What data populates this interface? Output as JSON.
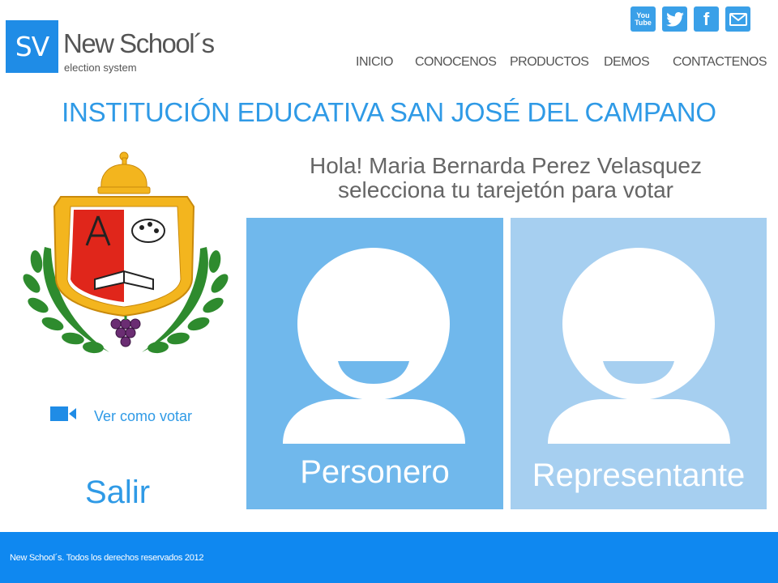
{
  "brand": {
    "initials": "SV",
    "name": "New School´s",
    "tagline": "election system",
    "color": "#1f8ce6"
  },
  "social": [
    {
      "name": "youtube-icon",
      "line1": "You",
      "line2": "Tube"
    },
    {
      "name": "twitter-icon"
    },
    {
      "name": "facebook-icon",
      "glyph": "f"
    },
    {
      "name": "email-icon"
    }
  ],
  "nav": {
    "items": [
      {
        "label": "INICIO"
      },
      {
        "label": "CONOCENOS"
      },
      {
        "label": "PRODUCTOS"
      },
      {
        "label": "DEMOS"
      },
      {
        "label": "CONTACTENOS"
      }
    ]
  },
  "page": {
    "title": "INSTITUCIÓN EDUCATIVA SAN JOSÉ DEL CAMPANO",
    "greeting_line1": "Hola!  Maria Bernarda Perez Velasquez",
    "greeting_line2": "selecciona tu tarejetón para votar",
    "video_link": "Ver como votar",
    "logout": "Salir"
  },
  "ballots": [
    {
      "label": "Personero",
      "color": "#70b8ec",
      "icon": "person-icon"
    },
    {
      "label": "Representante",
      "color": "#a6cff0",
      "icon": "person-icon"
    }
  ],
  "footer": {
    "text": "New School´s. Todos los derechos reservados 2012",
    "color": "#0f88f0"
  },
  "colors": {
    "accent": "#2f9ae6",
    "text_gray": "#555555"
  }
}
